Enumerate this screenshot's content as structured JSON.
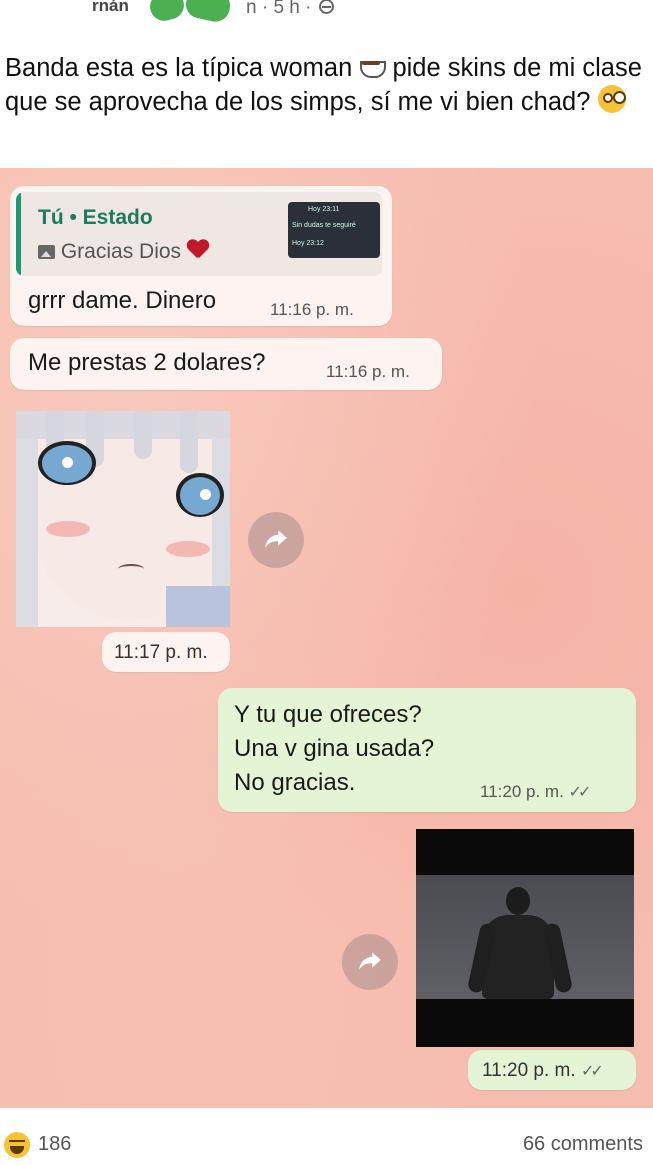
{
  "post": {
    "author": "rnán",
    "meta": "n · 5 h ·",
    "caption_part1": "Banda esta es la típica woman ",
    "caption_part2": " pide skins de mi clase que se aprovecha de los simps, sí me vi bien chad? "
  },
  "chat": {
    "reply_title": "Tú • Estado",
    "reply_subtitle": "Gracias Dios",
    "reply_thumb_lines": [
      "Hoy 23:11",
      "Sin dudas te seguiré",
      "Hoy 23:12"
    ],
    "msg1_text": "grrr dame. Dinero",
    "msg1_time": "11:16 p. m.",
    "msg2_text": "Me prestas 2 dolares?",
    "msg2_time": "11:16 p. m.",
    "sticker1_time": "11:17 p. m.",
    "msg3_lines": [
      "Y tu que ofreces?",
      "Una v  gina usada?",
      "No gracias."
    ],
    "msg3_time": "11:20 p. m.",
    "sticker2_time": "11:20 p. m.",
    "ticks": "✓✓"
  },
  "footer": {
    "reaction_count": "186",
    "comments": "66 comments"
  },
  "colors": {
    "chat_bg": "#f6bcae",
    "incoming": "#fdf3f0",
    "outgoing": "#e4f5d6",
    "reply_accent": "#1c9a74",
    "scribble": "#4caf50"
  }
}
